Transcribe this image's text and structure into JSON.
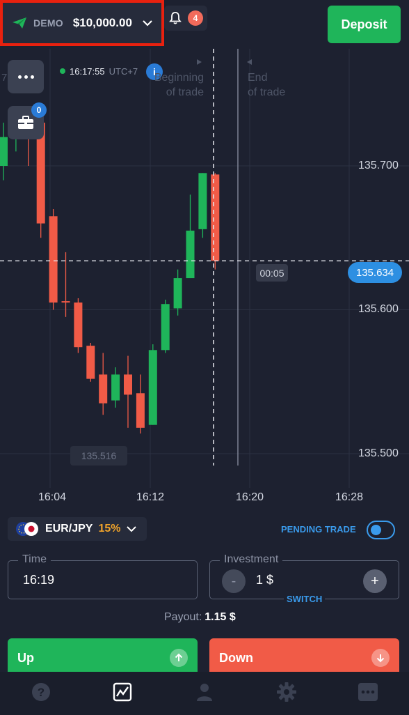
{
  "account": {
    "mode": "DEMO",
    "balance": "$10,000.00"
  },
  "notifications": {
    "count": "4"
  },
  "deposit_label": "Deposit",
  "clock": {
    "time": "16:17:55",
    "timezone": "UTC+7"
  },
  "info_glyph": "i",
  "trades_badge": "0",
  "trade_markers": {
    "begin_line1": "Beginning",
    "begin_line2": "of trade",
    "end_line1": "End",
    "end_line2": "of trade"
  },
  "partial_left_label": "7",
  "chart_data": {
    "type": "candlestick",
    "y_ticks": [
      "135.700",
      "135.600",
      "135.500"
    ],
    "x_ticks": [
      "16:04",
      "16:12",
      "16:20",
      "16:28"
    ],
    "current_price": "135.634",
    "countdown": "00:05",
    "low_marker": "135.516",
    "ylim": [
      135.48,
      135.775
    ],
    "candles": [
      {
        "o": 135.7,
        "c": 135.72,
        "h": 135.73,
        "l": 135.69,
        "color": "up"
      },
      {
        "o": 135.72,
        "c": 135.73,
        "h": 135.74,
        "l": 135.71,
        "color": "up"
      },
      {
        "o": 135.735,
        "c": 135.72,
        "h": 135.74,
        "l": 135.7,
        "color": "down"
      },
      {
        "o": 135.73,
        "c": 135.66,
        "h": 135.74,
        "l": 135.65,
        "color": "down"
      },
      {
        "o": 135.665,
        "c": 135.605,
        "h": 135.67,
        "l": 135.6,
        "color": "down"
      },
      {
        "o": 135.606,
        "c": 135.605,
        "h": 135.64,
        "l": 135.595,
        "color": "down"
      },
      {
        "o": 135.605,
        "c": 135.574,
        "h": 135.608,
        "l": 135.57,
        "color": "down"
      },
      {
        "o": 135.575,
        "c": 135.552,
        "h": 135.577,
        "l": 135.55,
        "color": "down"
      },
      {
        "o": 135.555,
        "c": 135.535,
        "h": 135.57,
        "l": 135.527,
        "color": "down"
      },
      {
        "o": 135.537,
        "c": 135.555,
        "h": 135.56,
        "l": 135.532,
        "color": "up"
      },
      {
        "o": 135.555,
        "c": 135.541,
        "h": 135.568,
        "l": 135.518,
        "color": "down"
      },
      {
        "o": 135.542,
        "c": 135.518,
        "h": 135.555,
        "l": 135.514,
        "color": "down"
      },
      {
        "o": 135.52,
        "c": 135.572,
        "h": 135.576,
        "l": 135.52,
        "color": "up"
      },
      {
        "o": 135.572,
        "c": 135.604,
        "h": 135.607,
        "l": 135.57,
        "color": "up"
      },
      {
        "o": 135.601,
        "c": 135.622,
        "h": 135.628,
        "l": 135.596,
        "color": "up"
      },
      {
        "o": 135.622,
        "c": 135.655,
        "h": 135.68,
        "l": 135.622,
        "color": "up"
      },
      {
        "o": 135.656,
        "c": 135.695,
        "h": 135.695,
        "l": 135.65,
        "color": "up"
      },
      {
        "o": 135.694,
        "c": 135.634,
        "h": 135.695,
        "l": 135.628,
        "color": "down"
      }
    ]
  },
  "asset": {
    "name": "EUR/JPY",
    "payout_pct": "15%"
  },
  "pending_trade_label": "PENDING TRADE",
  "time_field": {
    "legend": "Time",
    "value": "16:19"
  },
  "investment_field": {
    "legend": "Investment",
    "value": "1 $",
    "minus": "-",
    "plus": "+",
    "switch": "SWITCH"
  },
  "payout": {
    "label": "Payout:",
    "value": "1.15 $"
  },
  "buttons": {
    "up": "Up",
    "down": "Down"
  },
  "colors": {
    "up": "#1fb55a",
    "down": "#f15b47",
    "accent": "#2d8fe2",
    "highlight": "#e8210f"
  },
  "nav": [
    "help-icon",
    "chart-icon",
    "profile-icon",
    "settings-icon",
    "more-icon"
  ]
}
